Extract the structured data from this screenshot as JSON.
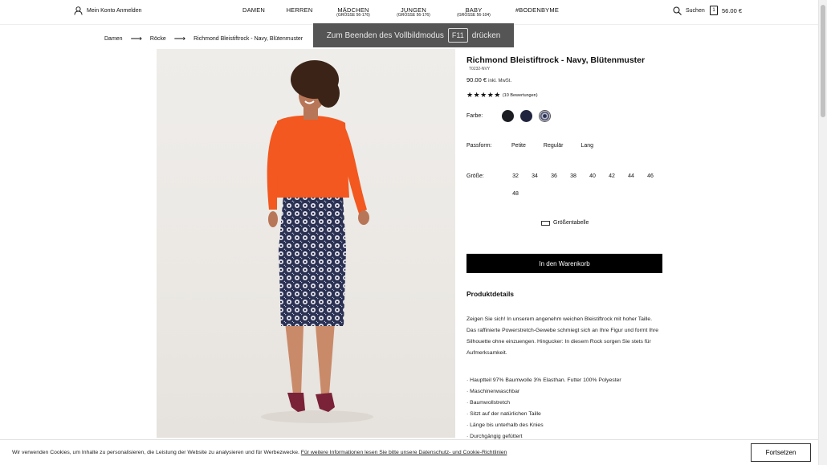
{
  "header": {
    "account_label": "Mein Konto Anmelden",
    "nav": [
      {
        "label": "DAMEN",
        "sub": ""
      },
      {
        "label": "HERREN",
        "sub": ""
      },
      {
        "label": "MÄDCHEN",
        "sub": "(GRÖSSE 56-176)"
      },
      {
        "label": "JUNGEN",
        "sub": "(GRÖSSE 56-176)"
      },
      {
        "label": "BABY",
        "sub": "(GRÖSSE 56-104)"
      },
      {
        "label": "#BODENBYME",
        "sub": ""
      }
    ],
    "search_label": "Suchen",
    "bag_count": "1",
    "bag_total": "56.00 €"
  },
  "breadcrumb": [
    "Damen",
    "Röcke",
    "Richmond Bleistiftrock - Navy, Blütenmuster"
  ],
  "fullscreen": {
    "before": "Zum Beenden des Vollbildmodus",
    "key": "F11",
    "after": "drücken"
  },
  "product": {
    "title": "Richmond Bleistiftrock - Navy, Blütenmuster",
    "sku": "T0232-NVY",
    "price": "90.00 €",
    "tax_note": "inkl. MwSt.",
    "stars": "★★★★★",
    "reviews": "(10 Bewertungen)",
    "color_label": "Farbe:",
    "colors": [
      "#1c1d22",
      "#20243e",
      "pattern"
    ],
    "fit_label": "Passform:",
    "fits": [
      "Petite",
      "Regulär",
      "Lang"
    ],
    "size_label": "Größe:",
    "sizes": [
      "32",
      "34",
      "36",
      "38",
      "40",
      "42",
      "44",
      "46",
      "48"
    ],
    "size_table": "Größentabelle",
    "add_to_cart": "In den Warenkorb",
    "details_title": "Produktdetails",
    "description": "Zeigen Sie sich! In unserem angenehm weichen Bleistiftrock mit hoher Taille. Das raffinierte Powerstretch-Gewebe schmiegt sich an Ihre Figur und formt Ihre Silhouette ohne einzuengen. Hingucker: In diesem Rock sorgen Sie stets für Aufmerksamkeit.",
    "bullets": [
      "Hauptteil 97% Baumwolle 3% Elasthan. Futter 100% Polyester",
      "Maschinenwaschbar",
      "Baumwollstretch",
      "Sitzt auf der natürlichen Taille",
      "Länge bis unterhalb des Knies",
      "Durchgängig gefüttert"
    ]
  },
  "cookie": {
    "text": "Wir verwenden Cookies, um Inhalte zu personalisieren, die Leistung der Website zu analysieren und für Werbezwecke.",
    "link": "Für weitere Informationen lesen Sie bitte unsere Datenschutz- und Cookie-Richtlinien",
    "button": "Fortsetzen"
  },
  "colors": {
    "accent": "#000000",
    "sweater": "#f2581f",
    "skirt_navy": "#2a3152",
    "shoes": "#7a2238"
  }
}
